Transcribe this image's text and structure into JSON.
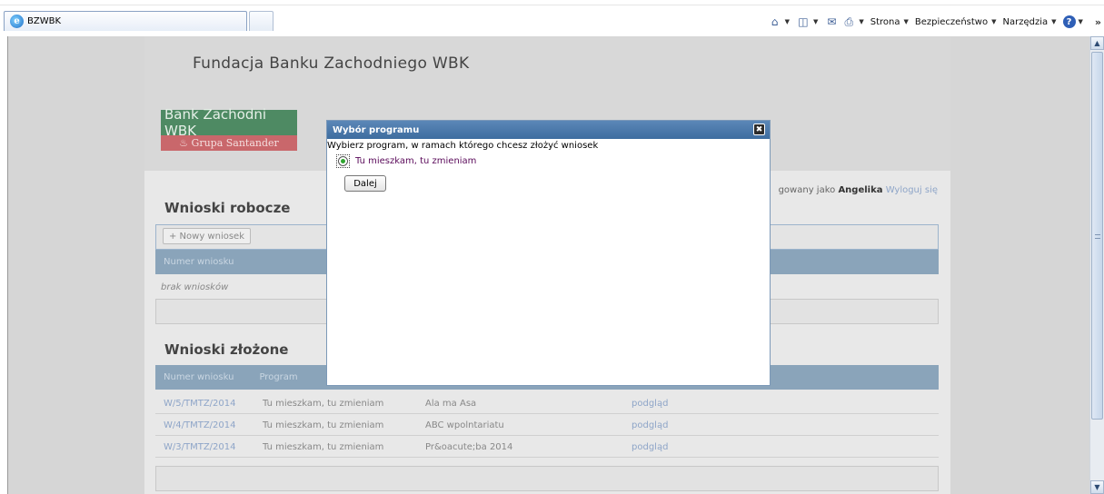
{
  "browser": {
    "tab_title": "BZWBK",
    "ie_glyph": "e",
    "toolbar": {
      "page_label": "Strona",
      "security_label": "Bezpieczeństwo",
      "tools_label": "Narzędzia",
      "help_glyph": "?",
      "more_glyph": "»"
    }
  },
  "site": {
    "title": "Fundacja Banku Zachodniego WBK",
    "logo_top": "Bank Zachodni WBK",
    "logo_bottom": "Grupa Santander",
    "logged_prefix": "gowany jako",
    "user": "Angelika",
    "logout": "Wyloguj się"
  },
  "drafts": {
    "title": "Wnioski robocze",
    "new_button": "+ Nowy wniosek",
    "col_number": "Numer wniosku",
    "empty": "brak wniosków"
  },
  "submitted": {
    "title": "Wnioski złożone",
    "col_number": "Numer wniosku",
    "col_program": "Program",
    "rows": [
      {
        "number": "W/5/TMTZ/2014",
        "program": "Tu mieszkam, tu zmieniam",
        "name": "Ala ma Asa",
        "link": "podgląd"
      },
      {
        "number": "W/4/TMTZ/2014",
        "program": "Tu mieszkam, tu zmieniam",
        "name": "ABC wpolntariatu",
        "link": "podgląd"
      },
      {
        "number": "W/3/TMTZ/2014",
        "program": "Tu mieszkam, tu zmieniam",
        "name": "Pr&oacute;ba 2014",
        "link": "podgląd"
      }
    ]
  },
  "modal": {
    "title": "Wybór programu",
    "close_glyph": "✖",
    "prompt": "Wybierz program, w ramach którego chcesz złożyć wniosek",
    "option": "Tu mieszkam, tu zmieniam",
    "next_button": "Dalej"
  },
  "colors": {
    "modal_header": "#4a79aa",
    "table_header": "#8aa4ba",
    "link": "#8ea5c8"
  }
}
